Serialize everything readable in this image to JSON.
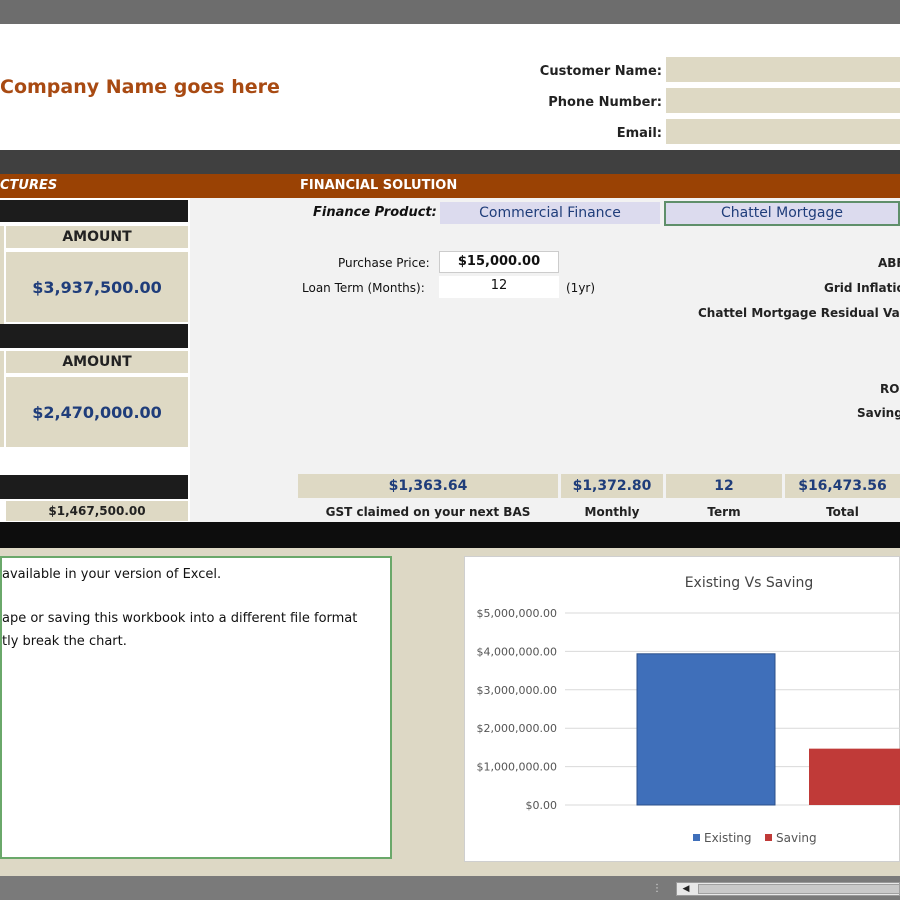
{
  "header": {
    "company_name": "Company Name goes here",
    "customer_name_label": "Customer Name:",
    "customer_name_value": "",
    "phone_label": "Phone Number:",
    "phone_value": "",
    "email_label": "Email:",
    "email_value": ""
  },
  "bands": {
    "left_section_title": "CTURES",
    "financial_solution_title": "FINANCIAL SOLUTION"
  },
  "left_panel": {
    "section1_amount_header": "AMOUNT",
    "section1_amount_value": "$3,937,500.00",
    "section2_amount_header": "AMOUNT",
    "section2_amount_value": "$2,470,000.00",
    "section3_amount_value": "$1,467,500.00"
  },
  "finance": {
    "product_label": "Finance Product:",
    "product_value": "Commercial Finance",
    "product_type": "Chattel Mortgage",
    "purchase_price_label": "Purchase Price:",
    "purchase_price_value": "$15,000.00",
    "loan_term_label": "Loan Term (Months):",
    "loan_term_value": "12",
    "loan_term_note": "(1yr)",
    "right_label_1": "ABF",
    "right_label_2": "Grid Inflatio",
    "right_label_3": "Chattel Mortgage Residual Valu",
    "right_label_4": "RO",
    "right_label_5": "Saving"
  },
  "summary": {
    "gst_value": "$1,363.64",
    "gst_label": "GST claimed on your next BAS",
    "monthly_value": "$1,372.80",
    "monthly_label": "Monthly",
    "term_value": "12",
    "term_label": "Term",
    "total_value": "$16,473.56",
    "total_label": "Total"
  },
  "message": {
    "line1": "available in your version of Excel.",
    "line2": "ape or saving this workbook into a different file format",
    "line3": "tly break the chart."
  },
  "chart_data": {
    "type": "bar",
    "title": "Existing Vs Saving",
    "categories": [
      ""
    ],
    "series": [
      {
        "name": "Existing",
        "values": [
          3937500
        ],
        "color": "#3f6fba"
      },
      {
        "name": "Saving",
        "values": [
          1467500
        ],
        "color": "#c03a38"
      }
    ],
    "ylim": [
      0,
      5000000
    ],
    "yticks": [
      "$0.00",
      "$1,000,000.00",
      "$2,000,000.00",
      "$3,000,000.00",
      "$4,000,000.00",
      "$5,000,000.00"
    ],
    "grid": true,
    "legend": "bottom"
  },
  "colors": {
    "brand_orange": "#9a4204",
    "company_text": "#a84a12",
    "tan": "#ded9c4",
    "value_blue": "#1f3d7a"
  }
}
